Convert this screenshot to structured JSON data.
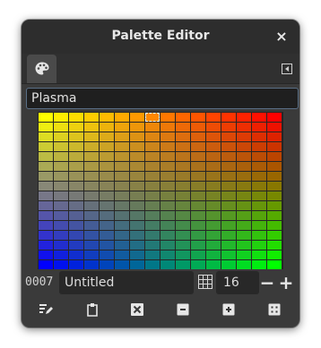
{
  "window": {
    "title": "Palette Editor",
    "close_label": "×"
  },
  "palette_name": "Plasma",
  "entry": {
    "index": "0007",
    "name": "Untitled"
  },
  "columns": {
    "value": "16",
    "decrement_label": "−",
    "increment_label": "+"
  },
  "grid": {
    "columns": 16,
    "rows": 16,
    "selected_index": 7
  },
  "colors": {
    "accent": "#5a6f86",
    "background": "#3a3a3a"
  }
}
